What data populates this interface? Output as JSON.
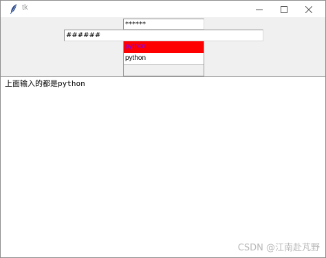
{
  "window": {
    "title": "tk"
  },
  "icons": {
    "app": "feather-icon",
    "minimize": "minimize-icon",
    "maximize": "maximize-icon",
    "close": "close-icon"
  },
  "entries": {
    "password_value": "******",
    "hash_value": "######"
  },
  "listbox": {
    "items": [
      "python",
      "python"
    ],
    "selected_index": 0,
    "selected_bg": "#ff0000",
    "selected_fg": "#7a00ff"
  },
  "text": {
    "line1": "上面输入的都是python"
  },
  "watermark": "CSDN @江南赴芃野"
}
